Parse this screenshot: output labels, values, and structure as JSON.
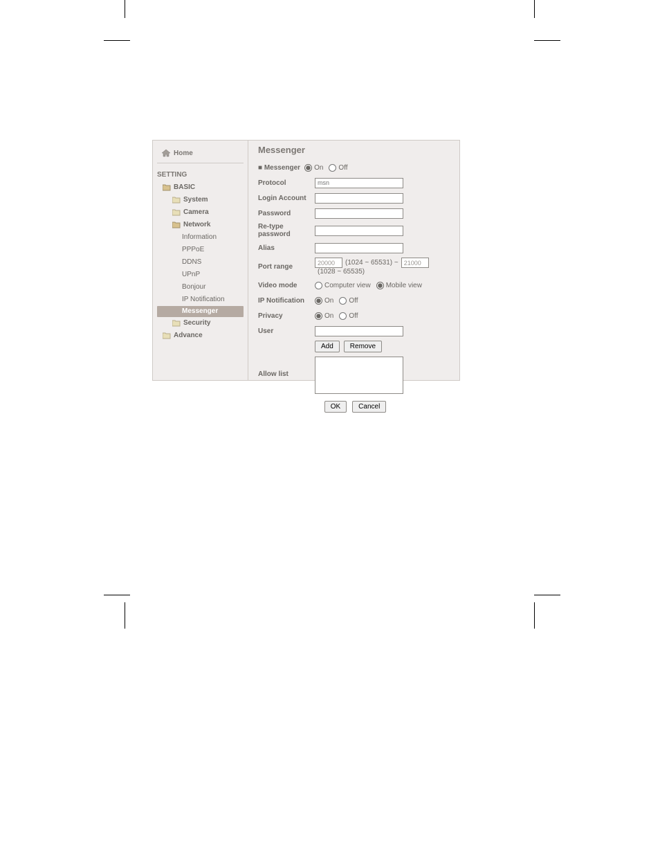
{
  "sidebar": {
    "home": "Home",
    "setting": "SETTING",
    "basic": "BASIC",
    "system": "System",
    "camera": "Camera",
    "network": "Network",
    "items": [
      "Information",
      "PPPoE",
      "DDNS",
      "UPnP",
      "Bonjour",
      "IP Notification",
      "Messenger"
    ],
    "security": "Security",
    "advance": "Advance"
  },
  "main": {
    "title": "Messenger",
    "messenger_label": "■ Messenger",
    "on": "On",
    "off": "Off",
    "fields": {
      "protocol": "Protocol",
      "login": "Login Account",
      "password": "Password",
      "retype": "Re-type password",
      "alias": "Alias",
      "portrange": "Port range",
      "videomode": "Video mode",
      "ipnotif": "IP Notification",
      "privacy": "Privacy",
      "user": "User",
      "allowlist": "Allow list"
    },
    "values": {
      "protocol": "msn",
      "port_start": "20000",
      "port_hint1": "(1024 ~ 65531) ~",
      "port_end": "21000",
      "port_hint2": "(1028 ~ 65535)"
    },
    "videomode": {
      "computer": "Computer view",
      "mobile": "Mobile view"
    },
    "buttons": {
      "add": "Add",
      "remove": "Remove",
      "ok": "OK",
      "cancel": "Cancel"
    }
  }
}
